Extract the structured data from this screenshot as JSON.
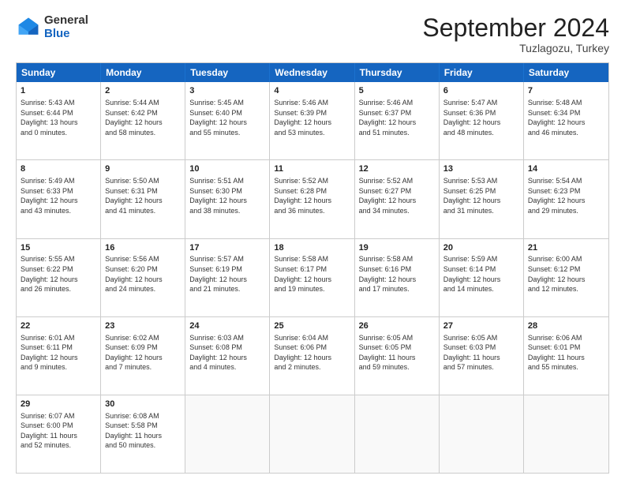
{
  "logo": {
    "general": "General",
    "blue": "Blue"
  },
  "header": {
    "month": "September 2024",
    "location": "Tuzlagozu, Turkey"
  },
  "weekdays": [
    "Sunday",
    "Monday",
    "Tuesday",
    "Wednesday",
    "Thursday",
    "Friday",
    "Saturday"
  ],
  "weeks": [
    [
      {
        "day": "1",
        "lines": [
          "Sunrise: 5:43 AM",
          "Sunset: 6:44 PM",
          "Daylight: 13 hours",
          "and 0 minutes."
        ]
      },
      {
        "day": "2",
        "lines": [
          "Sunrise: 5:44 AM",
          "Sunset: 6:42 PM",
          "Daylight: 12 hours",
          "and 58 minutes."
        ]
      },
      {
        "day": "3",
        "lines": [
          "Sunrise: 5:45 AM",
          "Sunset: 6:40 PM",
          "Daylight: 12 hours",
          "and 55 minutes."
        ]
      },
      {
        "day": "4",
        "lines": [
          "Sunrise: 5:46 AM",
          "Sunset: 6:39 PM",
          "Daylight: 12 hours",
          "and 53 minutes."
        ]
      },
      {
        "day": "5",
        "lines": [
          "Sunrise: 5:46 AM",
          "Sunset: 6:37 PM",
          "Daylight: 12 hours",
          "and 51 minutes."
        ]
      },
      {
        "day": "6",
        "lines": [
          "Sunrise: 5:47 AM",
          "Sunset: 6:36 PM",
          "Daylight: 12 hours",
          "and 48 minutes."
        ]
      },
      {
        "day": "7",
        "lines": [
          "Sunrise: 5:48 AM",
          "Sunset: 6:34 PM",
          "Daylight: 12 hours",
          "and 46 minutes."
        ]
      }
    ],
    [
      {
        "day": "8",
        "lines": [
          "Sunrise: 5:49 AM",
          "Sunset: 6:33 PM",
          "Daylight: 12 hours",
          "and 43 minutes."
        ]
      },
      {
        "day": "9",
        "lines": [
          "Sunrise: 5:50 AM",
          "Sunset: 6:31 PM",
          "Daylight: 12 hours",
          "and 41 minutes."
        ]
      },
      {
        "day": "10",
        "lines": [
          "Sunrise: 5:51 AM",
          "Sunset: 6:30 PM",
          "Daylight: 12 hours",
          "and 38 minutes."
        ]
      },
      {
        "day": "11",
        "lines": [
          "Sunrise: 5:52 AM",
          "Sunset: 6:28 PM",
          "Daylight: 12 hours",
          "and 36 minutes."
        ]
      },
      {
        "day": "12",
        "lines": [
          "Sunrise: 5:52 AM",
          "Sunset: 6:27 PM",
          "Daylight: 12 hours",
          "and 34 minutes."
        ]
      },
      {
        "day": "13",
        "lines": [
          "Sunrise: 5:53 AM",
          "Sunset: 6:25 PM",
          "Daylight: 12 hours",
          "and 31 minutes."
        ]
      },
      {
        "day": "14",
        "lines": [
          "Sunrise: 5:54 AM",
          "Sunset: 6:23 PM",
          "Daylight: 12 hours",
          "and 29 minutes."
        ]
      }
    ],
    [
      {
        "day": "15",
        "lines": [
          "Sunrise: 5:55 AM",
          "Sunset: 6:22 PM",
          "Daylight: 12 hours",
          "and 26 minutes."
        ]
      },
      {
        "day": "16",
        "lines": [
          "Sunrise: 5:56 AM",
          "Sunset: 6:20 PM",
          "Daylight: 12 hours",
          "and 24 minutes."
        ]
      },
      {
        "day": "17",
        "lines": [
          "Sunrise: 5:57 AM",
          "Sunset: 6:19 PM",
          "Daylight: 12 hours",
          "and 21 minutes."
        ]
      },
      {
        "day": "18",
        "lines": [
          "Sunrise: 5:58 AM",
          "Sunset: 6:17 PM",
          "Daylight: 12 hours",
          "and 19 minutes."
        ]
      },
      {
        "day": "19",
        "lines": [
          "Sunrise: 5:58 AM",
          "Sunset: 6:16 PM",
          "Daylight: 12 hours",
          "and 17 minutes."
        ]
      },
      {
        "day": "20",
        "lines": [
          "Sunrise: 5:59 AM",
          "Sunset: 6:14 PM",
          "Daylight: 12 hours",
          "and 14 minutes."
        ]
      },
      {
        "day": "21",
        "lines": [
          "Sunrise: 6:00 AM",
          "Sunset: 6:12 PM",
          "Daylight: 12 hours",
          "and 12 minutes."
        ]
      }
    ],
    [
      {
        "day": "22",
        "lines": [
          "Sunrise: 6:01 AM",
          "Sunset: 6:11 PM",
          "Daylight: 12 hours",
          "and 9 minutes."
        ]
      },
      {
        "day": "23",
        "lines": [
          "Sunrise: 6:02 AM",
          "Sunset: 6:09 PM",
          "Daylight: 12 hours",
          "and 7 minutes."
        ]
      },
      {
        "day": "24",
        "lines": [
          "Sunrise: 6:03 AM",
          "Sunset: 6:08 PM",
          "Daylight: 12 hours",
          "and 4 minutes."
        ]
      },
      {
        "day": "25",
        "lines": [
          "Sunrise: 6:04 AM",
          "Sunset: 6:06 PM",
          "Daylight: 12 hours",
          "and 2 minutes."
        ]
      },
      {
        "day": "26",
        "lines": [
          "Sunrise: 6:05 AM",
          "Sunset: 6:05 PM",
          "Daylight: 11 hours",
          "and 59 minutes."
        ]
      },
      {
        "day": "27",
        "lines": [
          "Sunrise: 6:05 AM",
          "Sunset: 6:03 PM",
          "Daylight: 11 hours",
          "and 57 minutes."
        ]
      },
      {
        "day": "28",
        "lines": [
          "Sunrise: 6:06 AM",
          "Sunset: 6:01 PM",
          "Daylight: 11 hours",
          "and 55 minutes."
        ]
      }
    ],
    [
      {
        "day": "29",
        "lines": [
          "Sunrise: 6:07 AM",
          "Sunset: 6:00 PM",
          "Daylight: 11 hours",
          "and 52 minutes."
        ]
      },
      {
        "day": "30",
        "lines": [
          "Sunrise: 6:08 AM",
          "Sunset: 5:58 PM",
          "Daylight: 11 hours",
          "and 50 minutes."
        ]
      },
      {
        "day": "",
        "lines": []
      },
      {
        "day": "",
        "lines": []
      },
      {
        "day": "",
        "lines": []
      },
      {
        "day": "",
        "lines": []
      },
      {
        "day": "",
        "lines": []
      }
    ]
  ]
}
